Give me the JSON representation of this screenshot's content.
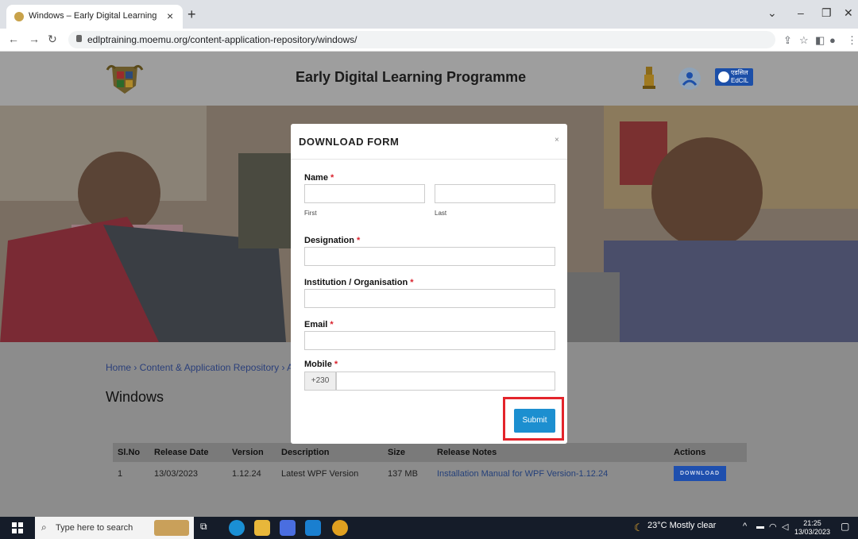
{
  "browser": {
    "tab_title": "Windows – Early Digital Learning",
    "new_tab": "+",
    "url": "edlptraining.moemu.org/content-application-repository/windows/"
  },
  "site": {
    "title": "Early Digital Learning Programme",
    "edcil_label": "एडसिल EdCIL"
  },
  "page": {
    "breadcrumb": "Home › Content & Application Repository › A",
    "heading": "Windows"
  },
  "table": {
    "headers": [
      "Sl.No",
      "Release Date",
      "Version",
      "Description",
      "Size",
      "Release Notes",
      "Actions"
    ],
    "rows": [
      {
        "sl": "1",
        "date": "13/03/2023",
        "version": "1.12.24",
        "description": "Latest WPF Version",
        "size": "137 MB",
        "notes": "Installation Manual for WPF Version-1.12.24",
        "action": "DOWNLOAD"
      }
    ]
  },
  "modal": {
    "title": "DOWNLOAD FORM",
    "close": "×",
    "name_label": "Name",
    "first_sub": "First",
    "last_sub": "Last",
    "designation_label": "Designation",
    "institution_label": "Institution / Organisation",
    "email_label": "Email",
    "mobile_label": "Mobile",
    "required_mark": "*",
    "mobile_prefix": "+230",
    "submit": "Submit"
  },
  "taskbar": {
    "search_placeholder": "Type here to search",
    "weather": "23°C  Mostly clear",
    "time": "21:25",
    "date": "13/03/2023"
  },
  "colors": {
    "accent": "#1c8fd0",
    "highlight": "#e3242b",
    "download_button": "#1e4fae"
  }
}
